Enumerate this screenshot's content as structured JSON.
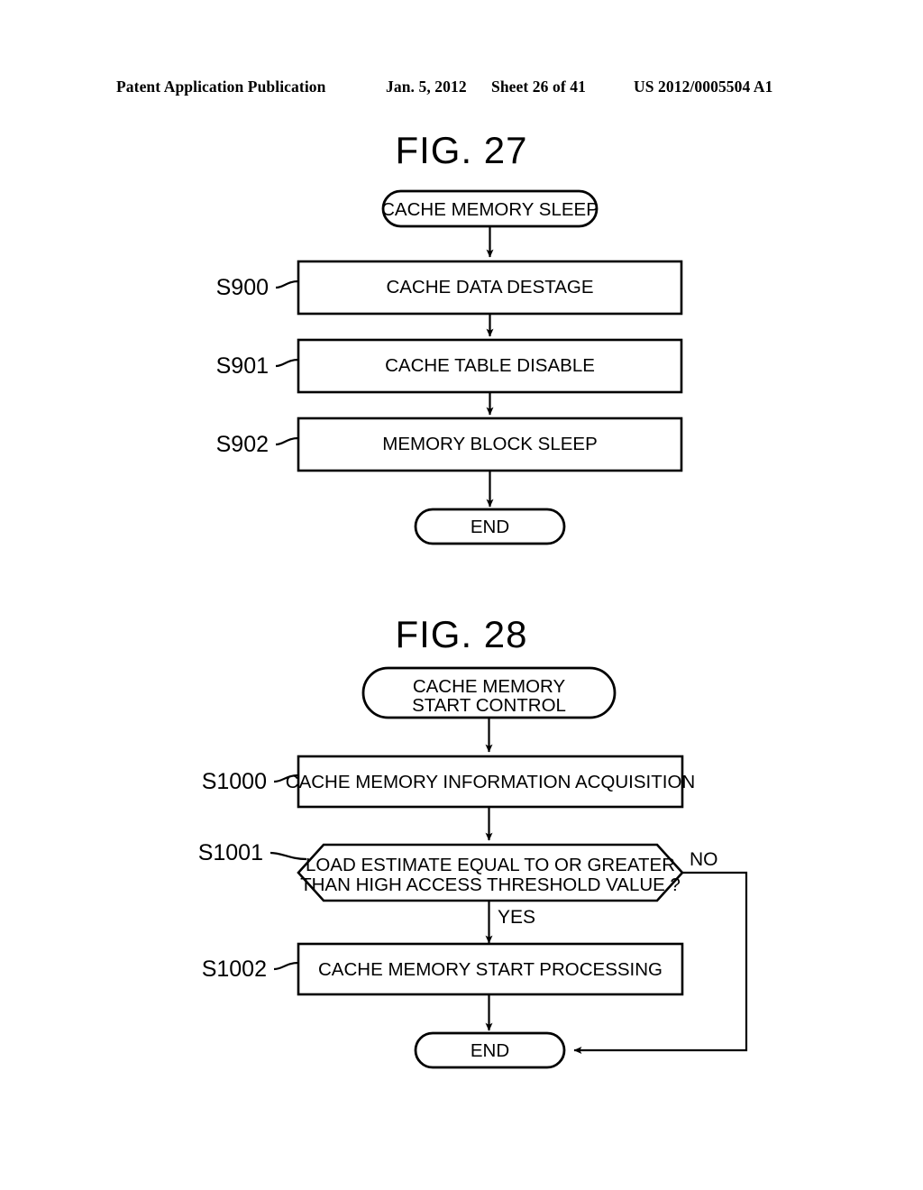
{
  "header": {
    "publication": "Patent Application Publication",
    "date": "Jan. 5, 2012",
    "sheet": "Sheet 26 of 41",
    "patent_number": "US 2012/0005504 A1"
  },
  "figures": [
    {
      "title": "FIG. 27",
      "start": {
        "label": "CACHE MEMORY SLEEP"
      },
      "steps": [
        {
          "id": "S900",
          "label": "CACHE DATA DESTAGE"
        },
        {
          "id": "S901",
          "label": "CACHE TABLE DISABLE"
        },
        {
          "id": "S902",
          "label": "MEMORY BLOCK SLEEP"
        }
      ],
      "end": {
        "label": "END"
      }
    },
    {
      "title": "FIG. 28",
      "start": {
        "line1": "CACHE MEMORY",
        "line2": "START CONTROL"
      },
      "steps": [
        {
          "id": "S1000",
          "label": "CACHE MEMORY INFORMATION ACQUISITION"
        },
        {
          "id": "S1001",
          "line1": "LOAD ESTIMATE EQUAL TO OR GREATER",
          "line2": "THAN HIGH ACCESS THRESHOLD VALUE ?",
          "yes": "YES",
          "no": "NO"
        },
        {
          "id": "S1002",
          "label": "CACHE MEMORY START PROCESSING"
        }
      ],
      "end": {
        "label": "END"
      }
    }
  ],
  "colors": {
    "ink": "#000000",
    "paper": "#ffffff"
  }
}
